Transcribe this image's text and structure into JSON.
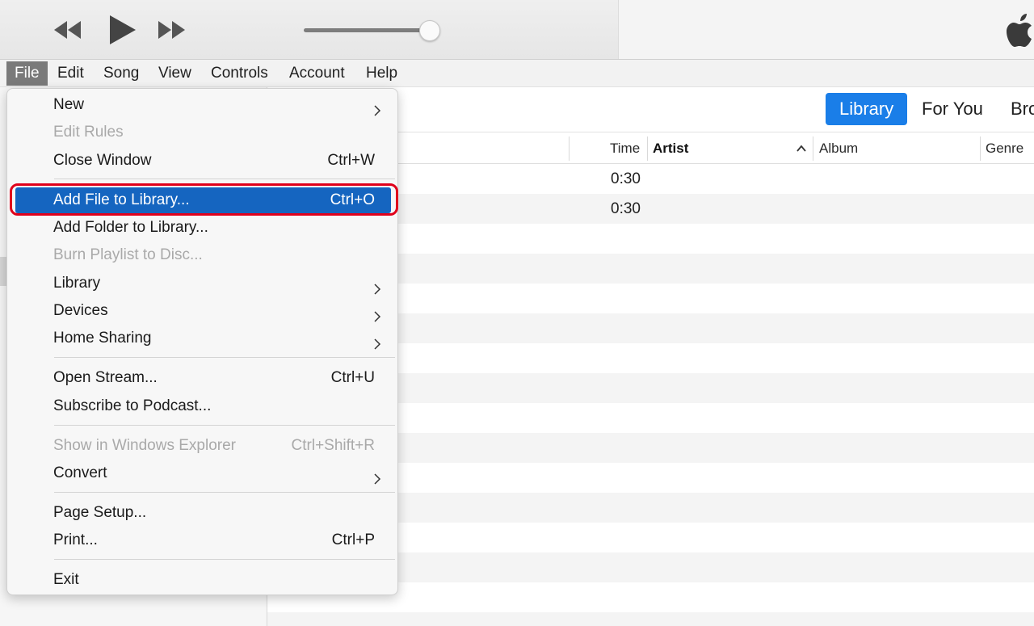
{
  "player": {
    "controls": [
      {
        "name": "rewind-icon"
      },
      {
        "name": "play-icon"
      },
      {
        "name": "fast-forward-icon"
      }
    ],
    "volume_level_percent": 96
  },
  "menubar": {
    "items": [
      "File",
      "Edit",
      "Song",
      "View",
      "Controls",
      "Account",
      "Help"
    ],
    "active": "File"
  },
  "tabs": {
    "items": [
      "Library",
      "For You",
      "Bro"
    ],
    "active": "Library"
  },
  "table": {
    "columns": [
      "Time",
      "Artist",
      "Album",
      "Genre"
    ],
    "sorted_column": "Artist",
    "rows": [
      {
        "time": "0:30"
      },
      {
        "time": "0:30"
      }
    ]
  },
  "file_menu": {
    "items": [
      {
        "label": "New",
        "submenu": true
      },
      {
        "label": "Edit Rules",
        "disabled": true
      },
      {
        "label": "Close Window",
        "shortcut": "Ctrl+W"
      },
      {
        "label": "Add File to Library...",
        "shortcut": "Ctrl+O",
        "highlighted": true
      },
      {
        "label": "Add Folder to Library..."
      },
      {
        "label": "Burn Playlist to Disc...",
        "disabled": true
      },
      {
        "label": "Library",
        "submenu": true
      },
      {
        "label": "Devices",
        "submenu": true
      },
      {
        "label": "Home Sharing",
        "submenu": true
      },
      {
        "label": "Open Stream...",
        "shortcut": "Ctrl+U"
      },
      {
        "label": "Subscribe to Podcast..."
      },
      {
        "label": "Show in Windows Explorer",
        "shortcut": "Ctrl+Shift+R",
        "disabled": true
      },
      {
        "label": "Convert",
        "submenu": true
      },
      {
        "label": "Page Setup..."
      },
      {
        "label": "Print...",
        "shortcut": "Ctrl+P"
      },
      {
        "label": "Exit"
      }
    ]
  },
  "colors": {
    "accent": "#1a7ee8",
    "menu_highlight": "#1565c0",
    "callout": "#e0001b"
  }
}
